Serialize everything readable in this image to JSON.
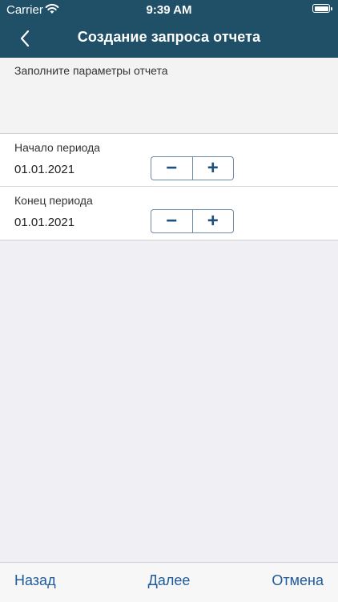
{
  "status_bar": {
    "carrier": "Carrier",
    "time": "9:39 AM"
  },
  "nav": {
    "title": "Создание запроса отчета"
  },
  "intro": {
    "text": "Заполните параметры отчета"
  },
  "fields": [
    {
      "label": "Начало периода",
      "value": "01.01.2021"
    },
    {
      "label": "Конец периода",
      "value": "01.01.2021"
    }
  ],
  "stepper": {
    "minus": "−",
    "plus": "+"
  },
  "toolbar": {
    "back": "Назад",
    "next": "Далее",
    "cancel": "Отмена"
  },
  "colors": {
    "header": "#1f5068",
    "accent": "#1f5a9a",
    "background": "#efeff4"
  }
}
